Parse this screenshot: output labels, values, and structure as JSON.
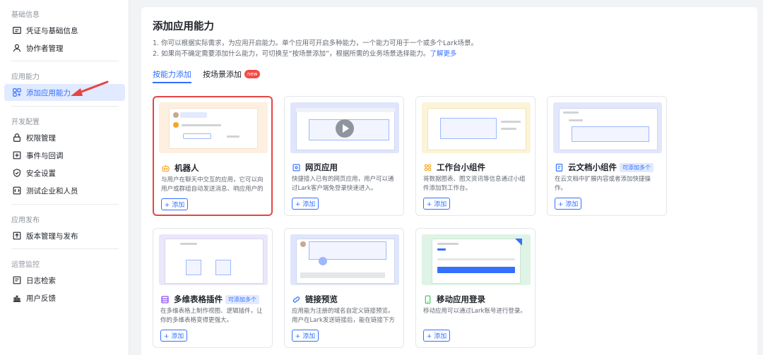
{
  "sidebar": {
    "sections": [
      {
        "title": "基础信息",
        "items": [
          {
            "label": "凭证与基础信息",
            "icon": "id-card-icon"
          },
          {
            "label": "协作者管理",
            "icon": "user-icon"
          }
        ]
      },
      {
        "title": "应用能力",
        "items": [
          {
            "label": "添加应用能力",
            "icon": "apps-add-icon",
            "active": true
          }
        ]
      },
      {
        "title": "开发配置",
        "items": [
          {
            "label": "权限管理",
            "icon": "lock-icon"
          },
          {
            "label": "事件与回调",
            "icon": "event-icon"
          },
          {
            "label": "安全设置",
            "icon": "shield-icon"
          },
          {
            "label": "测试企业和人员",
            "icon": "test-icon"
          }
        ]
      },
      {
        "title": "应用发布",
        "items": [
          {
            "label": "版本管理与发布",
            "icon": "upload-icon"
          }
        ]
      },
      {
        "title": "运营监控",
        "items": [
          {
            "label": "日志检索",
            "icon": "log-icon"
          },
          {
            "label": "用户反馈",
            "icon": "chart-icon"
          }
        ]
      }
    ]
  },
  "main": {
    "title": "添加应用能力",
    "desc1": "1. 你可以根据实际需求，为应用开启能力。单个应用可开启多种能力，一个能力可用于一个或多个Lark场景。",
    "desc2_text": "2. 如果尚不确定需要添加什么能力，可切换至“按场景添加”，根据所需的业务场景选择能力。",
    "desc2_link": "了解更多",
    "tabs": [
      {
        "label": "按能力添加",
        "active": true
      },
      {
        "label": "按场景添加",
        "badge": "new"
      }
    ],
    "add_label": "+ 添加",
    "cards": [
      {
        "title": "机器人",
        "icon": "robot-icon",
        "desc": "与用户在聊天中交互的应用，它可以向用户或群组自动发送消息、响应用户的消息",
        "highlighted": true
      },
      {
        "title": "网页应用",
        "icon": "web-icon",
        "desc": "快捷接入已有的网页应用，用户可以通过Lark客户端免登录快速进入。"
      },
      {
        "title": "工作台小组件",
        "icon": "widget-icon",
        "desc": "将数据图表、图文资讯等信息通过小组件添加到工作台。"
      },
      {
        "title": "云文档小组件",
        "icon": "doc-icon",
        "badge": "可添加多个",
        "desc": "在云文档中扩展内容或者添加快捷操作。"
      },
      {
        "title": "多维表格插件",
        "icon": "table-icon",
        "badge": "可添加多个",
        "desc": "在多维表格上制作视图、逻辑插件，让你的多维表格变得更强大。"
      },
      {
        "title": "链接预览",
        "icon": "link-icon",
        "desc": "应用能为注册的域名自定义链接预览。用户在Lark发送链接后，能在链接下方展示"
      },
      {
        "title": "移动应用登录",
        "icon": "mobile-icon",
        "desc": "移动应用可以通过Lark账号进行登录。"
      }
    ]
  },
  "colors": {
    "accent": "#3370ff",
    "highlight": "#e54545",
    "new_badge": "#f54a45"
  }
}
